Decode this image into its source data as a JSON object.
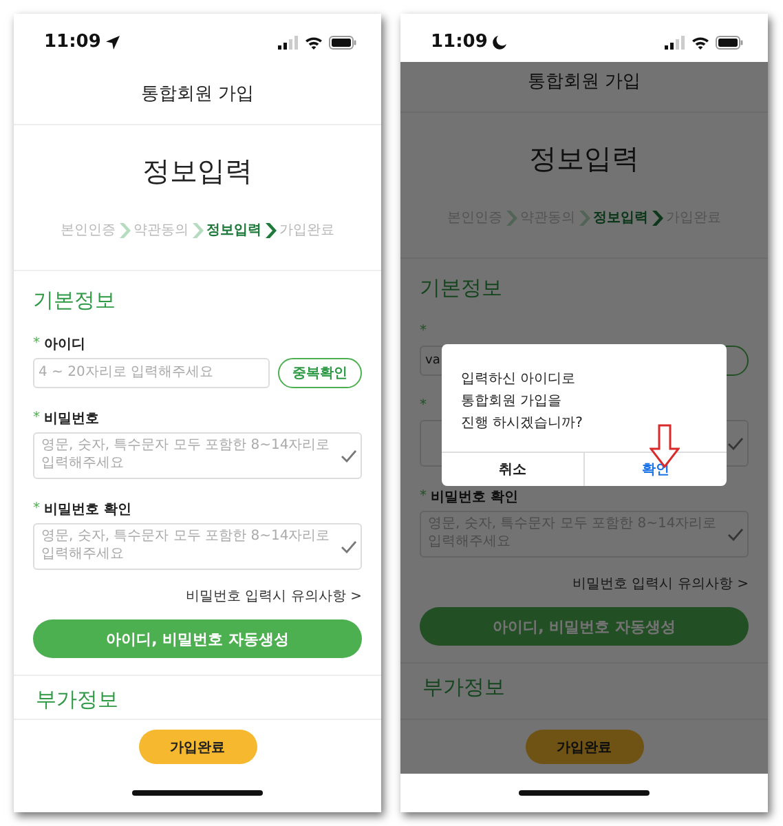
{
  "phones": [
    {
      "status_bar": {
        "kind": "location",
        "time": "11:09"
      },
      "scrolled": false,
      "dimmed": false,
      "header_title": "통합회원 가입",
      "page_title": "정보입력",
      "steps": [
        {
          "label": "본인인증",
          "selected": false
        },
        {
          "label": "약관동의",
          "selected": false
        },
        {
          "label": "정보입력",
          "selected": true
        },
        {
          "label": "가입완료",
          "selected": false
        }
      ],
      "section_title": "기본정보",
      "fields": [
        {
          "kind": "id",
          "mark": "*",
          "label": "아이디",
          "placeholder": "4 ~ 20자리로 입력해주세요",
          "button": "중복확인"
        },
        {
          "kind": "password",
          "mark": "*",
          "label": "비밀번호",
          "placeholder": "영문, 숫자, 특수문자 모두 포함한 8~14자리로 입력해주세요"
        },
        {
          "kind": "password",
          "mark": "*",
          "label": "비밀번호 확인",
          "placeholder": "영문, 숫자, 특수문자 모두 포함한 8~14자리로 입력해주세요"
        }
      ],
      "notice_link": "비밀번호 입력시 유의사항",
      "notice_arrow": ">",
      "auto_button": "아이디, 비밀번호 자동생성",
      "next_section_title": "부가정보",
      "complete_button": "가입완료"
    },
    {
      "status_bar": {
        "kind": "moon",
        "time": "11:09"
      },
      "scrolled": true,
      "dimmed": true,
      "header_title": "통합회원 가입",
      "page_title": "정보입력",
      "steps": [
        {
          "label": "본인인증",
          "selected": false
        },
        {
          "label": "약관동의",
          "selected": false
        },
        {
          "label": "정보입력",
          "selected": true
        },
        {
          "label": "가입완료",
          "selected": false
        }
      ],
      "section_title": "기본정보",
      "fields": [
        {
          "kind": "id",
          "mark": "*",
          "value": "va"
        },
        {
          "kind": "password",
          "mark": "*"
        },
        {
          "kind": "password",
          "mark": "*",
          "label": "비밀번호 확인",
          "placeholder": "영문, 숫자, 특수문자 모두 포함한 8~14자리로 입력해주세요"
        }
      ],
      "notice_link": "비밀번호 입력시 유의사항",
      "notice_arrow": ">",
      "auto_button": "아이디, 비밀번호 자동생성",
      "next_section_title": "부가정보",
      "complete_button": "가입완료",
      "dialog": {
        "message": "입력하신 아이디로\n통합회원 가입을\n진행 하시겠습니까?",
        "buttons": [
          {
            "kind": "cancel",
            "label": "취소"
          },
          {
            "kind": "confirm",
            "label": "확인"
          }
        ]
      }
    }
  ]
}
